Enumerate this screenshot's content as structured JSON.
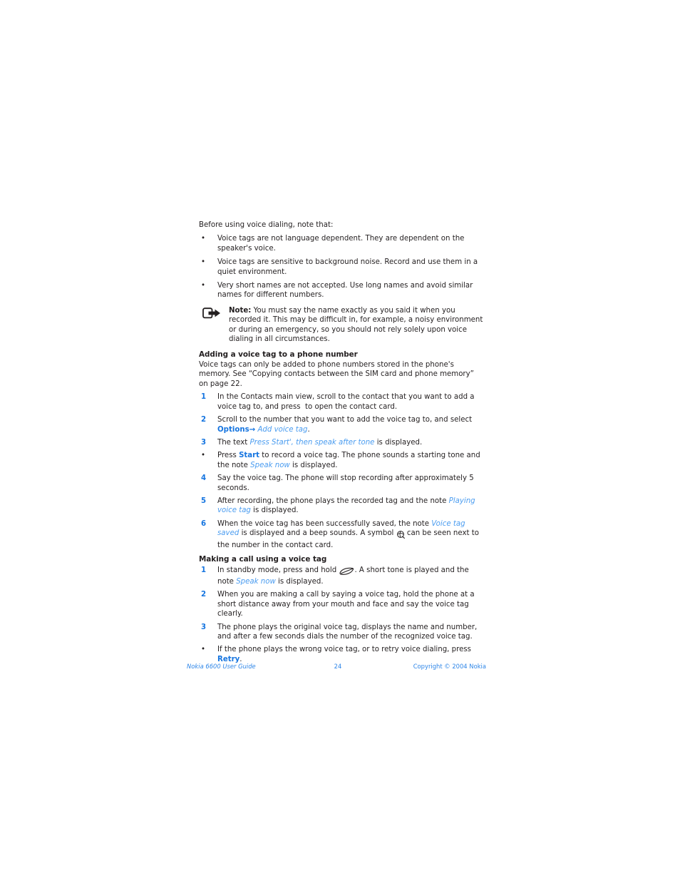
{
  "document": {
    "intro": "Before using voice dialing, note that:",
    "intro_bullets": [
      "Voice tags are not language dependent. They are dependent on the speaker's voice.",
      "Voice tags are sensitive to background noise. Record and use them in a quiet environment.",
      "Very short names are not accepted. Use long names and avoid similar names for different numbers."
    ],
    "note": {
      "icon": "note-arrow-icon",
      "label": "Note:",
      "text": " You must say the name exactly as you said it when you recorded it. This may be difficult in, for example, a noisy environment or during an emergency, so you should not rely solely upon voice dialing in all circumstances."
    },
    "section_1": {
      "heading": "Adding a voice tag to a phone number",
      "body": "Voice tags can only be added to phone numbers stored in the phone's memory. See “Copying contacts between the SIM card and phone memory” on page 22.",
      "steps": [
        {
          "marker": "1",
          "type": "number",
          "segments": [
            {
              "kind": "plain",
              "text": "In the Contacts main view, scroll to the contact that you want to add a voice tag to, and press "
            },
            {
              "kind": "icon",
              "icon": "scroll-key-icon"
            },
            {
              "kind": "plain",
              "text": " to open the contact card."
            }
          ]
        },
        {
          "marker": "2",
          "type": "number",
          "segments": [
            {
              "kind": "plain",
              "text": "Scroll to the number that you want to add the voice tag to, and select "
            },
            {
              "kind": "bold-blue",
              "text": "Options"
            },
            {
              "kind": "arrow",
              "text": "→"
            },
            {
              "kind": "plain",
              "text": " "
            },
            {
              "kind": "italic-blue",
              "text": "Add voice tag"
            },
            {
              "kind": "plain",
              "text": "."
            }
          ]
        },
        {
          "marker": "3",
          "type": "number",
          "segments": [
            {
              "kind": "plain",
              "text": "The text "
            },
            {
              "kind": "italic-blue",
              "text": "Press Start', then speak after tone"
            },
            {
              "kind": "plain",
              "text": " is displayed."
            }
          ]
        },
        {
          "marker": "•",
          "type": "bullet",
          "segments": [
            {
              "kind": "plain",
              "text": "Press "
            },
            {
              "kind": "bold-blue",
              "text": "Start"
            },
            {
              "kind": "plain",
              "text": " to record a voice tag. The phone sounds a starting tone and the note "
            },
            {
              "kind": "italic-blue",
              "text": "Speak now"
            },
            {
              "kind": "plain",
              "text": " is displayed."
            }
          ]
        },
        {
          "marker": "4",
          "type": "number",
          "segments": [
            {
              "kind": "plain",
              "text": "Say the voice tag. The phone will stop recording after approximately 5 seconds."
            }
          ]
        },
        {
          "marker": "5",
          "type": "number",
          "segments": [
            {
              "kind": "plain",
              "text": "After recording, the phone plays the recorded tag and the note "
            },
            {
              "kind": "italic-blue",
              "text": "Playing voice tag"
            },
            {
              "kind": "plain",
              "text": " is displayed."
            }
          ]
        },
        {
          "marker": "6",
          "type": "number",
          "segments": [
            {
              "kind": "plain",
              "text": "When the voice tag has been successfully saved, the note "
            },
            {
              "kind": "italic-blue",
              "text": "Voice tag saved"
            },
            {
              "kind": "plain",
              "text": " is displayed and a beep sounds. A symbol "
            },
            {
              "kind": "icon",
              "icon": "voice-tag-symbol-icon"
            },
            {
              "kind": "plain",
              "text": " can be seen next to the number in the contact card."
            }
          ]
        }
      ]
    },
    "section_2": {
      "heading": "Making a call using a voice tag",
      "steps": [
        {
          "marker": "1",
          "type": "number",
          "segments": [
            {
              "kind": "plain",
              "text": "In standby mode, press and hold "
            },
            {
              "kind": "icon",
              "icon": "right-selection-key-icon"
            },
            {
              "kind": "plain",
              "text": ". A short tone is played and the note "
            },
            {
              "kind": "italic-blue",
              "text": "Speak now"
            },
            {
              "kind": "plain",
              "text": " is displayed."
            }
          ]
        },
        {
          "marker": "2",
          "type": "number",
          "segments": [
            {
              "kind": "plain",
              "text": "When you are making a call by saying a voice tag, hold the phone at a short distance away from your mouth and face and say the voice tag clearly."
            }
          ]
        },
        {
          "marker": "3",
          "type": "number",
          "segments": [
            {
              "kind": "plain",
              "text": "The phone plays the original voice tag, displays the name and number, and after a few seconds dials the number of the recognized voice tag."
            }
          ]
        },
        {
          "marker": "•",
          "type": "bullet",
          "segments": [
            {
              "kind": "plain",
              "text": "If the phone plays the wrong voice tag, or to retry voice dialing, press "
            },
            {
              "kind": "bold-blue",
              "text": "Retry"
            },
            {
              "kind": "plain",
              "text": "."
            }
          ]
        }
      ]
    }
  },
  "footer": {
    "left": "Nokia 6600 User Guide",
    "page_number": "24",
    "right": "Copyright © 2004 Nokia"
  },
  "colors": {
    "accent_blue": "#1675e0",
    "italic_blue": "#4a9cf0",
    "footer_blue": "#2e86e8",
    "text_black": "#231f20"
  }
}
